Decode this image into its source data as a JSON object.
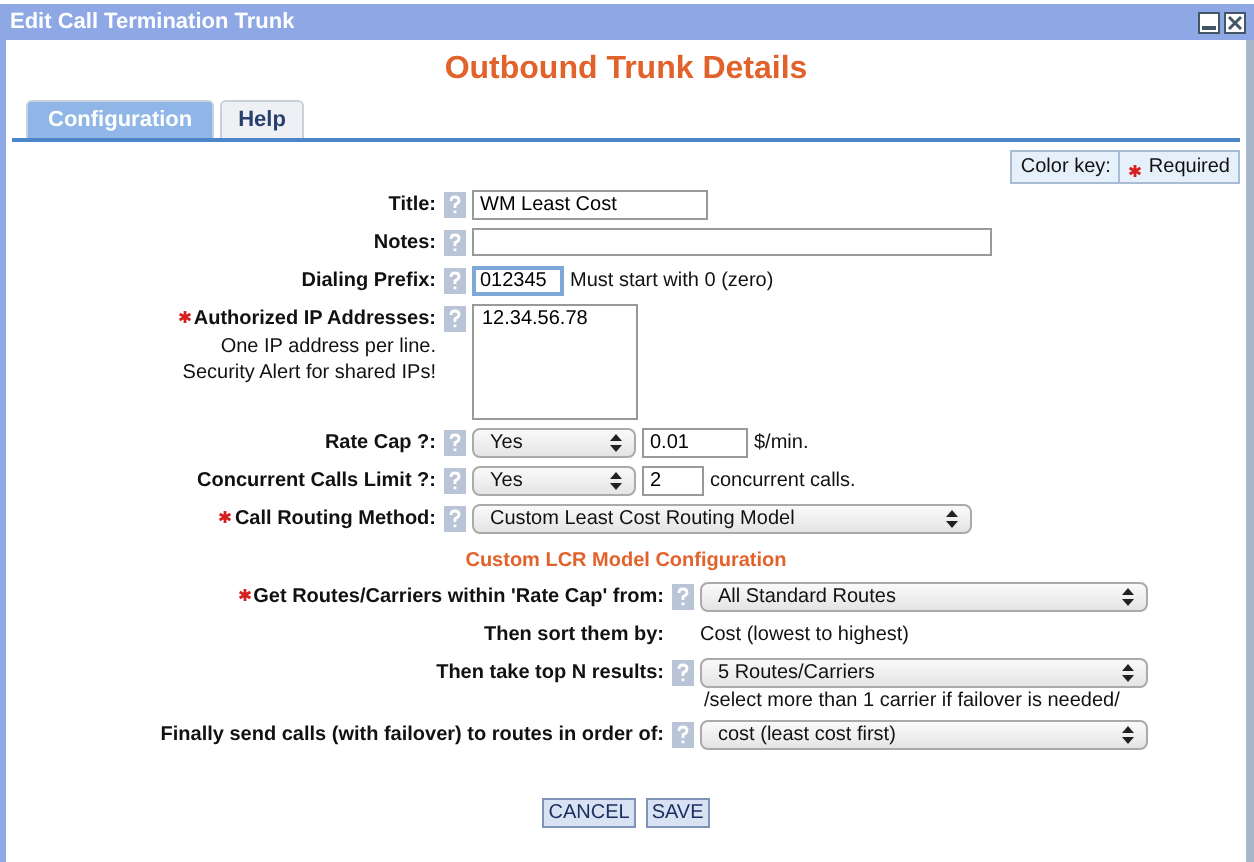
{
  "window": {
    "title": "Edit Call Termination Trunk"
  },
  "heading": "Outbound Trunk Details",
  "tabs": [
    {
      "label": "Configuration",
      "selected": true
    },
    {
      "label": "Help",
      "selected": false
    }
  ],
  "color_key": {
    "label": "Color key:",
    "required_label": "Required"
  },
  "fields": [
    {
      "kind": "text",
      "label": "Title:",
      "required": false,
      "help": true,
      "value": "WM Least Cost",
      "focused": false
    },
    {
      "kind": "textarea",
      "label": "Notes:",
      "required": false,
      "help": true
    },
    {
      "kind": "text",
      "label": "Dialing Prefix:",
      "required": false,
      "help": true,
      "value": "012345",
      "focused": true,
      "suffix": "Must start with 0 (zero)"
    },
    {
      "kind": "textarea",
      "label": "Authorized IP Addresses:",
      "required": true,
      "help": true,
      "notes": [
        "One IP address per line.",
        "Security Alert for shared IPs!"
      ],
      "value": "12.34.56.78"
    },
    {
      "kind": "select-input",
      "label": "Rate Cap ?:",
      "required": false,
      "help": true,
      "select": "Yes",
      "value": "0.01",
      "suffix": "$/min."
    },
    {
      "kind": "select-input",
      "label": "Concurrent Calls Limit ?:",
      "required": false,
      "help": true,
      "select": "Yes",
      "value": "2",
      "suffix": "concurrent calls."
    },
    {
      "kind": "select",
      "label": "Call Routing Method:",
      "required": true,
      "help": true,
      "select": "Custom Least Cost Routing Model"
    }
  ],
  "lcr": {
    "title": "Custom LCR Model Configuration",
    "fields": [
      {
        "kind": "select",
        "label": "Get Routes/Carriers within 'Rate Cap' from:",
        "required": true,
        "help": true,
        "select": "All Standard Routes"
      },
      {
        "kind": "static",
        "label": "Then sort them by:",
        "required": false,
        "help": false,
        "value": "Cost (lowest to highest)"
      },
      {
        "kind": "select",
        "label": "Then take top N results:",
        "required": false,
        "help": true,
        "select": "5 Routes/Carriers",
        "note": "/select more than 1 carrier if failover is needed/"
      },
      {
        "kind": "select",
        "label": "Finally send calls (with failover) to routes in order of:",
        "required": false,
        "help": true,
        "select": "cost (least cost first)"
      }
    ]
  },
  "buttons": [
    "CANCEL",
    "SAVE"
  ]
}
